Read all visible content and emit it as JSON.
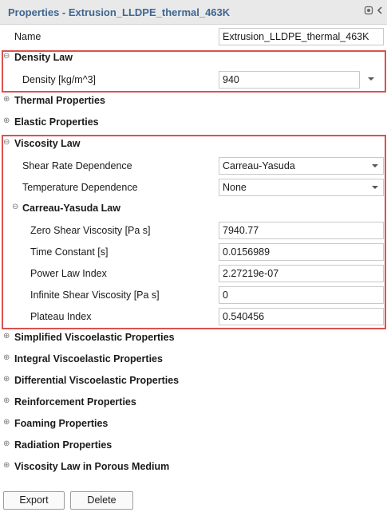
{
  "panel": {
    "title": "Properties - Extrusion_LLDPE_thermal_463K",
    "pin_icon": "pin-icon",
    "close_icon": "collapse-arrow-icon"
  },
  "name_row": {
    "label": "Name",
    "value": "Extrusion_LLDPE_thermal_463K"
  },
  "density_law": {
    "section": "Density Law",
    "expanded": true,
    "density_label": "Density [kg/m^3]",
    "density_value": "940"
  },
  "collapsed_sections_top": [
    "Thermal Properties",
    "Elastic Properties"
  ],
  "viscosity_law": {
    "section": "Viscosity Law",
    "expanded": true,
    "shear_rate_label": "Shear Rate Dependence",
    "shear_rate_value": "Carreau-Yasuda",
    "temperature_label": "Temperature Dependence",
    "temperature_value": "None",
    "sub_section": "Carreau-Yasuda Law",
    "params": [
      {
        "label": "Zero Shear Viscosity [Pa s]",
        "value": "7940.77"
      },
      {
        "label": "Time Constant [s]",
        "value": "0.0156989"
      },
      {
        "label": "Power Law Index",
        "value": "2.27219e-07"
      },
      {
        "label": "Infinite Shear Viscosity [Pa s]",
        "value": "0"
      },
      {
        "label": "Plateau Index",
        "value": "0.540456"
      }
    ]
  },
  "collapsed_sections_bottom": [
    "Simplified Viscoelastic Properties",
    "Integral Viscoelastic Properties",
    "Differential Viscoelastic Properties",
    "Reinforcement Properties",
    "Foaming Properties",
    "Radiation Properties",
    "Viscosity Law in Porous Medium"
  ],
  "buttons": {
    "export": "Export",
    "delete": "Delete"
  },
  "colors": {
    "title_text": "#3f6690",
    "highlight": "#d9534f"
  }
}
